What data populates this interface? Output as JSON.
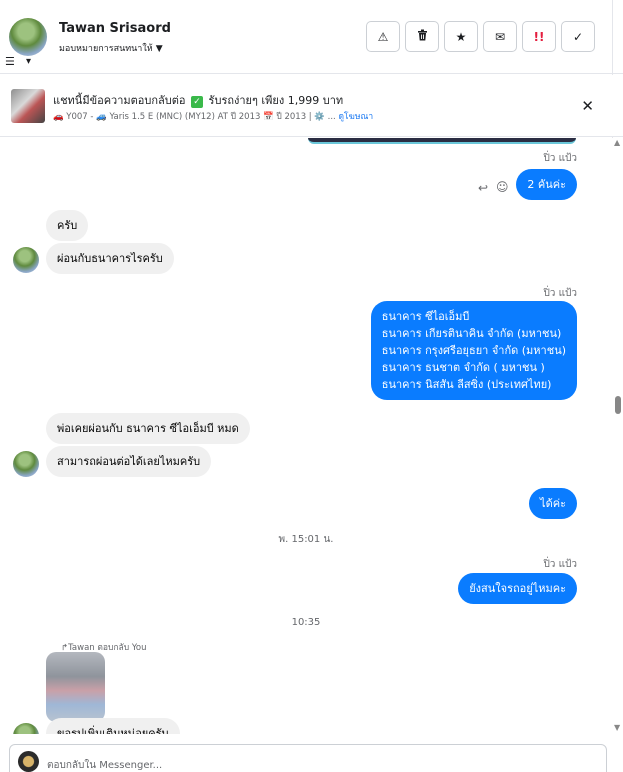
{
  "header": {
    "name": "Tawan Srisaord",
    "assign_label": "มอบหมายการสนทนาให้",
    "actions": [
      {
        "icon": "warning-icon",
        "glyph": "⚠"
      },
      {
        "icon": "trash-icon",
        "glyph": "🗑"
      },
      {
        "icon": "star-icon",
        "glyph": "★"
      },
      {
        "icon": "mail-icon",
        "glyph": "✉"
      },
      {
        "icon": "spam-icon",
        "glyph": "!!"
      },
      {
        "icon": "check-icon",
        "glyph": "✓"
      }
    ]
  },
  "ad": {
    "title_part1": "แชทนี้มีข้อความตอบกลับต่อ",
    "title_part2": "รับรถง่ายๆ เพียง 1,999 บาท",
    "subtitle": "🚗 Y007 - 🚙 Yaris 1.5 E (MNC) (MY12) AT ปี 2013 📅 ปี 2013 | ⚙️ ...",
    "link": "ดูโฆษณา"
  },
  "chat": {
    "seen1": "ปิ่ว แป้ว",
    "out1": "2 คันค่ะ",
    "in1": "ครับ",
    "in2": "ผ่อนกับธนาคารไรครับ",
    "seen2": "ปิ่ว แป้ว",
    "out2_lines": [
      "ธนาคาร ซีไอเอ็มบี",
      "ธนาคาร เกียรตินาคิน จำกัด (มหาชน)",
      "ธนาคาร กรุงศรีอยุธยา จำกัด (มหาชน)",
      "ธนาคาร ธนชาต จำกัด ( มหาชน )",
      "ธนาคาร  นิสสัน ลีสซิ่ง (ประเทศไทย)"
    ],
    "in3": "พ่อเคยผ่อนกับ ธนาคาร ซีไอเอ็มบี หมด",
    "in4": "สามารถผ่อนต่อได้เลยไหมครับ",
    "out3": "ได้ค่ะ",
    "timestamp1": "พ. 15:01 น.",
    "seen3": "ปิ่ว แป้ว",
    "out4": "ยังสนใจรถอยู่ไหมคะ",
    "timestamp2": "10:35",
    "reply_note": "Tawan ตอบกลับ You",
    "in5_partial": "ขอรูปเพิ่มเติมหน่อยครับ"
  },
  "composer": {
    "placeholder": "ตอบกลับใน Messenger..."
  }
}
